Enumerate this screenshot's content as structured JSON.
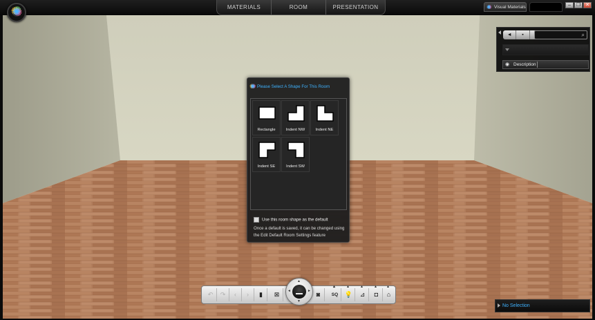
{
  "nav": {
    "tabs": [
      "MATERIALS",
      "ROOM",
      "PRESENTATION"
    ]
  },
  "top_right": {
    "visual_materials_tab": "Visual Materials"
  },
  "right_panel": {
    "nav_left": "◄",
    "nav_menu": "▪",
    "nav_right": "►",
    "search_icon": "⌕",
    "description_label": "Description"
  },
  "dialog": {
    "title": "Please Select A Shape For This Room",
    "shapes": [
      {
        "label": "Rectangle"
      },
      {
        "label": "Indent NW"
      },
      {
        "label": "Indent NE"
      },
      {
        "label": "Indent SE"
      },
      {
        "label": "Indent SW"
      }
    ],
    "default_checkbox_label": "Use this room shape as the default",
    "note": "Once a default is saved, it can be changed using the Edit Default Room Settings feature"
  },
  "toolbar": {
    "sq_label": "SQ"
  },
  "status": {
    "selection": "No Selection"
  },
  "colors": {
    "accent": "#3fb2ff",
    "floor": "#b57a55",
    "wall": "#d9d8c4"
  }
}
